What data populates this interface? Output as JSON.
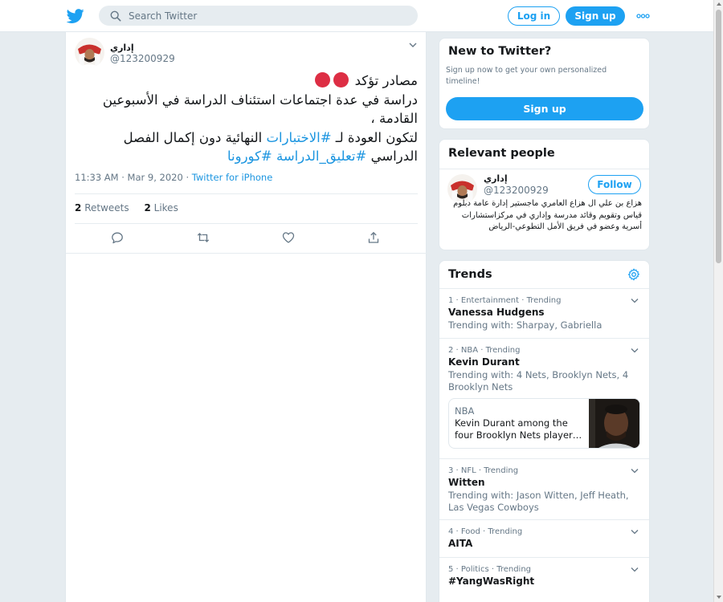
{
  "header": {
    "logo_icon": "twitter-bird-icon",
    "search_placeholder": "Search Twitter",
    "login_label": "Log in",
    "signup_label": "Sign up",
    "more_icon": "more-dots-icon"
  },
  "tweet": {
    "author_name": "إداري",
    "author_handle": "@123200929",
    "text": {
      "line1": "مصادر تؤكد",
      "line2": "دراسة في عدة اجتماعات استئناف الدراسة في  الأسبوعين القادمة ،",
      "line3_prefix": "لتكون العودة لـ ",
      "hashtag1": "#الاختبارات",
      "line3_suffix": " النهائية دون إكمال الفصل الدراسي ",
      "hashtag2": "#تعليق_الدراسة",
      "hashtag3": "#كورونا"
    },
    "timestamp": "11:33 AM · Mar 9, 2020 ·",
    "source": "Twitter for iPhone",
    "retweets_count": "2",
    "retweets_label": "Retweets",
    "likes_count": "2",
    "likes_label": "Likes"
  },
  "new_to_twitter": {
    "title": "New to Twitter?",
    "description": "Sign up now to get your own personalized timeline!",
    "signup_label": "Sign up"
  },
  "relevant_people": {
    "title": "Relevant people",
    "name": "إداري",
    "handle": "@123200929",
    "follow_label": "Follow",
    "bio": "هزاع بن علي ال هزاع العامري ماجستير إدارة عامة دبلوم قياس وتقويم وقائد مدرسة وإداري في مركزاستشارات أسرية وعضو في فريق الأمل التطوعي-الرياض"
  },
  "trends": {
    "title": "Trends",
    "items": [
      {
        "meta": "1 · Entertainment · Trending",
        "name": "Vanessa Hudgens",
        "with": "Trending with: Sharpay, Gabriella"
      },
      {
        "meta": "2 · NBA · Trending",
        "name": "Kevin Durant",
        "with": "Trending with: 4 Nets, Brooklyn Nets, 4 Brooklyn Nets",
        "news_source": "NBA",
        "news_headline": "Kevin Durant among the four Brooklyn Nets player…"
      },
      {
        "meta": "3 · NFL · Trending",
        "name": "Witten",
        "with": "Trending with: Jason Witten, Jeff Heath, Las Vegas Cowboys"
      },
      {
        "meta": "4 · Food · Trending",
        "name": "AITA"
      },
      {
        "meta": "5 · Politics · Trending",
        "name": "#YangWasRight"
      }
    ]
  }
}
